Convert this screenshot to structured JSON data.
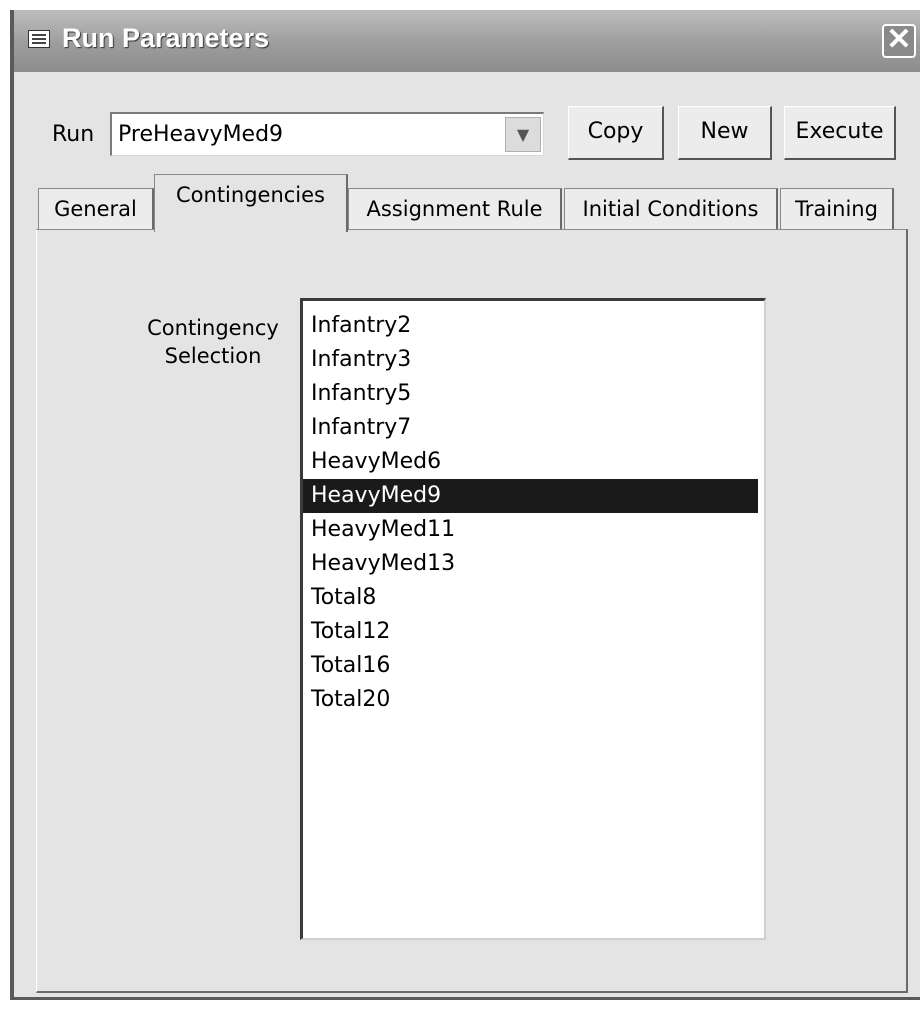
{
  "window": {
    "title": "Run Parameters",
    "close_glyph": "✕"
  },
  "run": {
    "label": "Run",
    "value": "PreHeavyMed9",
    "dropdown_glyph": "▼"
  },
  "buttons": {
    "copy": "Copy",
    "new": "New",
    "execute": "Execute"
  },
  "tabs": [
    {
      "label": "General",
      "active": false
    },
    {
      "label": "Contingencies",
      "active": true
    },
    {
      "label": "Assignment Rule",
      "active": false
    },
    {
      "label": "Initial Conditions",
      "active": false
    },
    {
      "label": "Training",
      "active": false
    }
  ],
  "contingency": {
    "label_line1": "Contingency",
    "label_line2": "Selection",
    "items": [
      "Infantry2",
      "Infantry3",
      "Infantry5",
      "Infantry7",
      "HeavyMed6",
      "HeavyMed9",
      "HeavyMed11",
      "HeavyMed13",
      "Total8",
      "Total12",
      "Total16",
      "Total20"
    ],
    "selected": "HeavyMed9"
  },
  "icons": {
    "window_icon": "form-icon",
    "close": "close-icon",
    "dropdown": "chevron-down-icon"
  }
}
